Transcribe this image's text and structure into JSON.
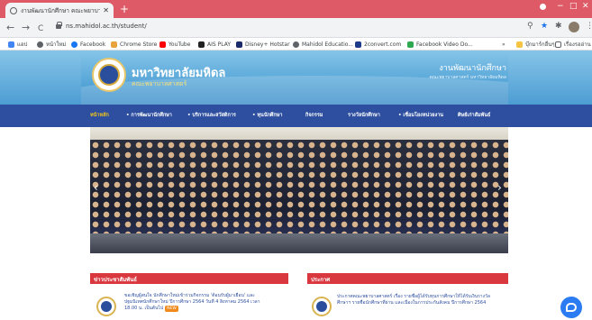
{
  "browser": {
    "tab_title": "งานพัฒนานักศึกษา คณะพยาบาลศาสตร์",
    "tab_close": "✕",
    "new_tab": "+",
    "url": "ns.mahidol.ac.th/student/",
    "win_minimize": "−",
    "win_maximize": "□",
    "win_close": "✕",
    "nav_back": "←",
    "nav_forward": "→",
    "nav_reload": "C",
    "zoom_icon": "🔍",
    "star_icon": "★",
    "ext_icon": "✱",
    "menu_icon": "⋮",
    "bookmarks": [
      {
        "label": "แอป",
        "color": "#4285f4"
      },
      {
        "label": "หน้าใหม่",
        "color": "#5f6368"
      },
      {
        "label": "Facebook",
        "color": "#1877f2"
      },
      {
        "label": "Chrome Store",
        "color": "#e8a33d"
      },
      {
        "label": "YouTube",
        "color": "#ff0000"
      },
      {
        "label": "AIS PLAY",
        "color": "#222222"
      },
      {
        "label": "Disney+ Hotstar",
        "color": "#1b2a6b"
      },
      {
        "label": "Mahidol Educatio...",
        "color": "#5f6368"
      },
      {
        "label": "2convert.com",
        "color": "#1e3a8a"
      },
      {
        "label": "Facebook Video Do...",
        "color": "#2fa84f"
      }
    ],
    "bookmarks_more": "»",
    "other_bookmarks": "บุ๊กมาร์กอื่นๆ",
    "reading_list": "เรื่องรออ่าน",
    "folder_color": "#f6c343"
  },
  "site": {
    "university": "มหาวิทยาลัยมหิดล",
    "faculty": "คณะพยาบาลศาสตร์",
    "department": "งานพัฒนานักศึกษา",
    "department_sub": "คณะพยาบาลศาสตร์ มหาวิทยาลัยมหิดล",
    "menu": [
      {
        "label": "หน้าหลัก",
        "active": true
      },
      {
        "label": "• การพัฒนานักศึกษา",
        "active": false
      },
      {
        "label": "• บริการและสวัสดิการ",
        "active": false
      },
      {
        "label": "• ทุนนักศึกษา",
        "active": false
      },
      {
        "label": "กิจกรรม",
        "active": false
      },
      {
        "label": "รางวัลนักศึกษา",
        "active": false
      },
      {
        "label": "• เชื่อมโยงหน่วยงาน",
        "active": false
      },
      {
        "label": "ศิษย์เก่าสัมพันธ์",
        "active": false
      }
    ],
    "slider_prev": "‹",
    "slider_next": "›",
    "news_left": {
      "header": "ข่าวประชาสัมพันธ์",
      "line1": "ขอเชิญผู้สนใจ นักศึกษาใหม่เข้าร่วมกิจกรรม 'ต้อนรับผู้มาเยือน' และ",
      "line2": "ปฐมนิเทศนักศึกษาใหม่ ปีการศึกษา 2564  วันที่ 4 สิงหาคม 2564 เวลา",
      "line3": "18.00 น. เป็นต้นไป",
      "badge": "NEW"
    },
    "news_right": {
      "header": "ประกาศ",
      "line1": "ประกาศคณะพยาบาลศาสตร์ เรื่อง รายชื่อผู้ได้รับทุนการศึกษาให้ได้รับเงินรางวัล",
      "line2": "ศึกษาฯ รายชื่อนักศึกษาที่ผ่าน และเนื่องในการประกันสังคม ปีการศึกษา 2564"
    }
  },
  "colors": {
    "tabbar": "#dd5a66",
    "menu": "#2e4fa0",
    "active_menu": "#f5c518",
    "section_header": "#d9383f",
    "messenger": "#2b7bf2"
  }
}
